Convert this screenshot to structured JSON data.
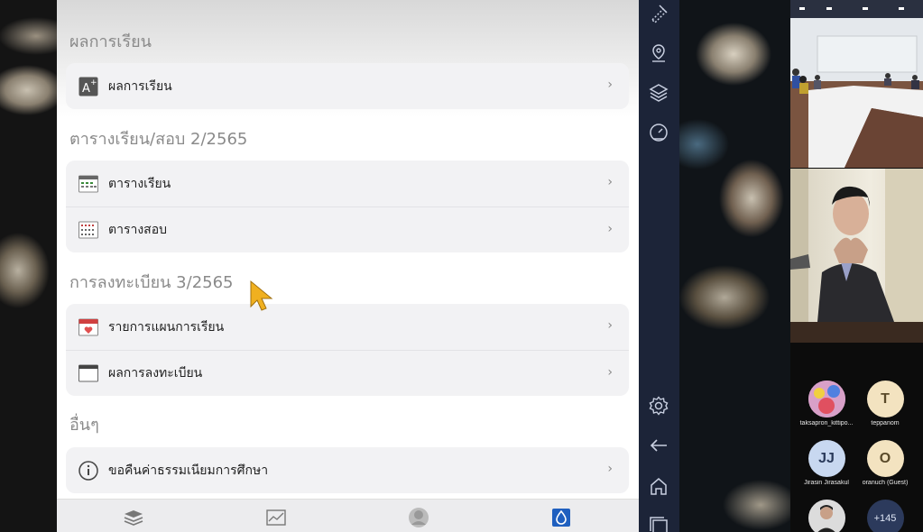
{
  "sections": [
    {
      "title": "ผลการเรียน",
      "items": [
        {
          "label": "ผลการเรียน",
          "icon": "grade-a-plus-icon"
        }
      ]
    },
    {
      "title": "ตารางเรียน/สอบ 2/2565",
      "items": [
        {
          "label": "ตารางเรียน",
          "icon": "class-calendar-icon"
        },
        {
          "label": "ตารางสอบ",
          "icon": "exam-calendar-icon"
        }
      ]
    },
    {
      "title": "การลงทะเบียน 3/2565",
      "items": [
        {
          "label": "รายการแผนการเรียน",
          "icon": "study-plan-icon"
        },
        {
          "label": "ผลการลงทะเบียน",
          "icon": "registration-result-icon"
        }
      ]
    },
    {
      "title": "อื่นๆ",
      "items": [
        {
          "label": "ขอคืนค่าธรรมเนียมการศึกษา",
          "icon": "info-icon"
        }
      ]
    }
  ],
  "chevron": "›",
  "bottom_tabs": [
    "layers-icon",
    "chart-icon",
    "profile-icon",
    "home-app-icon"
  ],
  "participants": [
    {
      "initial": "",
      "name": "taksapron_kittipo...",
      "color": "#c9a0d8"
    },
    {
      "initial": "T",
      "name": "teppanom",
      "color": "#f3e3c0"
    },
    {
      "initial": "JJ",
      "name": "Jirasin Jirasakul",
      "color": "#c8d8f0"
    },
    {
      "initial": "O",
      "name": "oranuch (Guest)",
      "color": "#f3e3c0"
    },
    {
      "initial": "",
      "name": "",
      "color": "#556"
    },
    {
      "initial": "+145",
      "name": "",
      "color": "#2c3a5c"
    }
  ],
  "colors": {
    "accent": "#1f5fbf",
    "nav_bg": "#1c2438",
    "cursor": "#f0b020"
  }
}
